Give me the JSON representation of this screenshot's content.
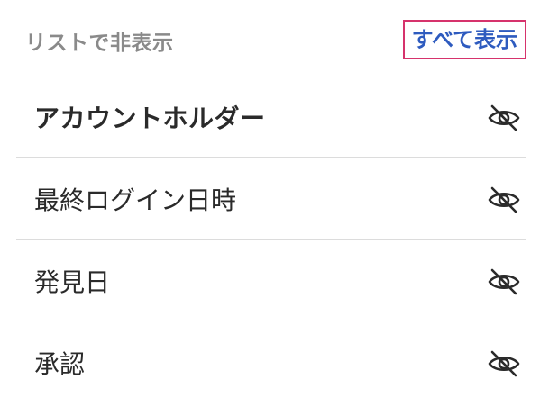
{
  "header": {
    "title": "リストで非表示",
    "show_all_label": "すべて表示"
  },
  "rows": [
    {
      "label": "アカウントホルダー",
      "icon": "eye-off-icon"
    },
    {
      "label": "最終ログイン日時",
      "icon": "eye-off-icon"
    },
    {
      "label": "発見日",
      "icon": "eye-off-icon"
    },
    {
      "label": "承認",
      "icon": "eye-off-icon"
    }
  ],
  "colors": {
    "header_text": "#8a8a8a",
    "link": "#2e5bbf",
    "focus_outline": "#d6336c",
    "row_text": "#2a2a2a",
    "divider": "#dcdcdc"
  }
}
